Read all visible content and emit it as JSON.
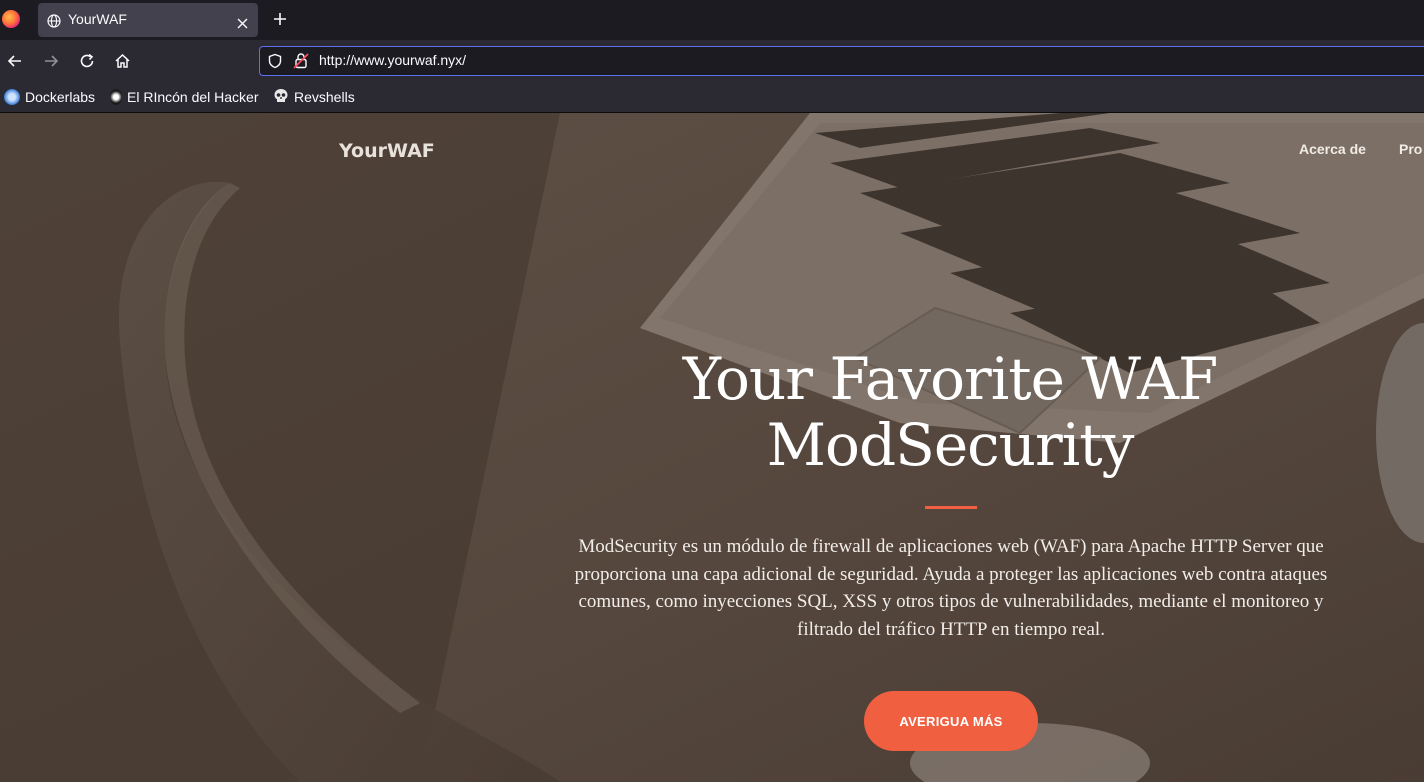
{
  "browser": {
    "tab_title": "YourWAF",
    "url": "http://www.yourwaf.nyx/",
    "bookmarks": [
      {
        "label": "Dockerlabs",
        "icon": "dockerlabs-icon"
      },
      {
        "label": "El RIncón del Hacker",
        "icon": "hacker-icon"
      },
      {
        "label": "Revshells",
        "icon": "skull-icon"
      }
    ]
  },
  "site": {
    "brand": "YourWAF",
    "nav": [
      "Acerca de",
      "Pro"
    ],
    "hero": {
      "title_line1": "Your Favorite WAF",
      "title_line2": "ModSecurity",
      "description": "ModSecurity es un módulo de firewall de aplicaciones web (WAF) para Apache HTTP Server que proporciona una capa adicional de seguridad. Ayuda a proteger las aplicaciones web contra ataques comunes, como inyecciones SQL, XSS y otros tipos de vulnerabilidades, mediante el monitoreo y filtrado del tráfico HTTP en tiempo real.",
      "cta_label": "AVERIGUA MÁS"
    }
  },
  "colors": {
    "accent": "#f05f40",
    "url_focus": "#5c6ff0"
  }
}
